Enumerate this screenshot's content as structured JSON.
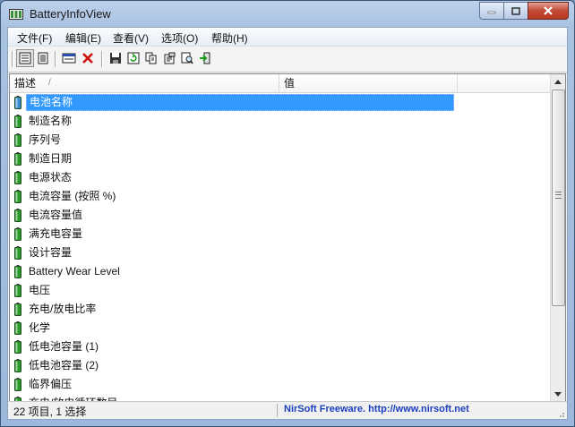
{
  "window": {
    "title": "BatteryInfoView",
    "icon": "battery-app-icon"
  },
  "menu": [
    "文件(F)",
    "编辑(E)",
    "查看(V)",
    "选项(O)",
    "帮助(H)"
  ],
  "toolbar": [
    "view-list-icon",
    "view-details-icon",
    "properties-icon",
    "delete-icon",
    "save-icon",
    "refresh-icon",
    "copy-icon",
    "html-report-icon",
    "find-icon",
    "exit-icon"
  ],
  "columns": {
    "description": "描述",
    "value": "值"
  },
  "rows": [
    {
      "label": "电池名称",
      "selected": true
    },
    {
      "label": "制造名称"
    },
    {
      "label": "序列号"
    },
    {
      "label": "制造日期"
    },
    {
      "label": "电源状态"
    },
    {
      "label": "电流容量 (按照 %)"
    },
    {
      "label": "电流容量值"
    },
    {
      "label": "满充电容量"
    },
    {
      "label": "设计容量"
    },
    {
      "label": "Battery Wear Level"
    },
    {
      "label": "电压"
    },
    {
      "label": "充电/放电比率"
    },
    {
      "label": "化学"
    },
    {
      "label": "低电池容量 (1)"
    },
    {
      "label": "低电池容量 (2)"
    },
    {
      "label": "临界偏压"
    },
    {
      "label": "充电/放电循环数目"
    }
  ],
  "status": {
    "left": "22 项目, 1 选择",
    "right": "NirSoft Freeware.  http://www.nirsoft.net"
  },
  "colors": {
    "selection": "#3399ff",
    "link": "#1a3fbf",
    "battery": "#2a9a2a"
  }
}
